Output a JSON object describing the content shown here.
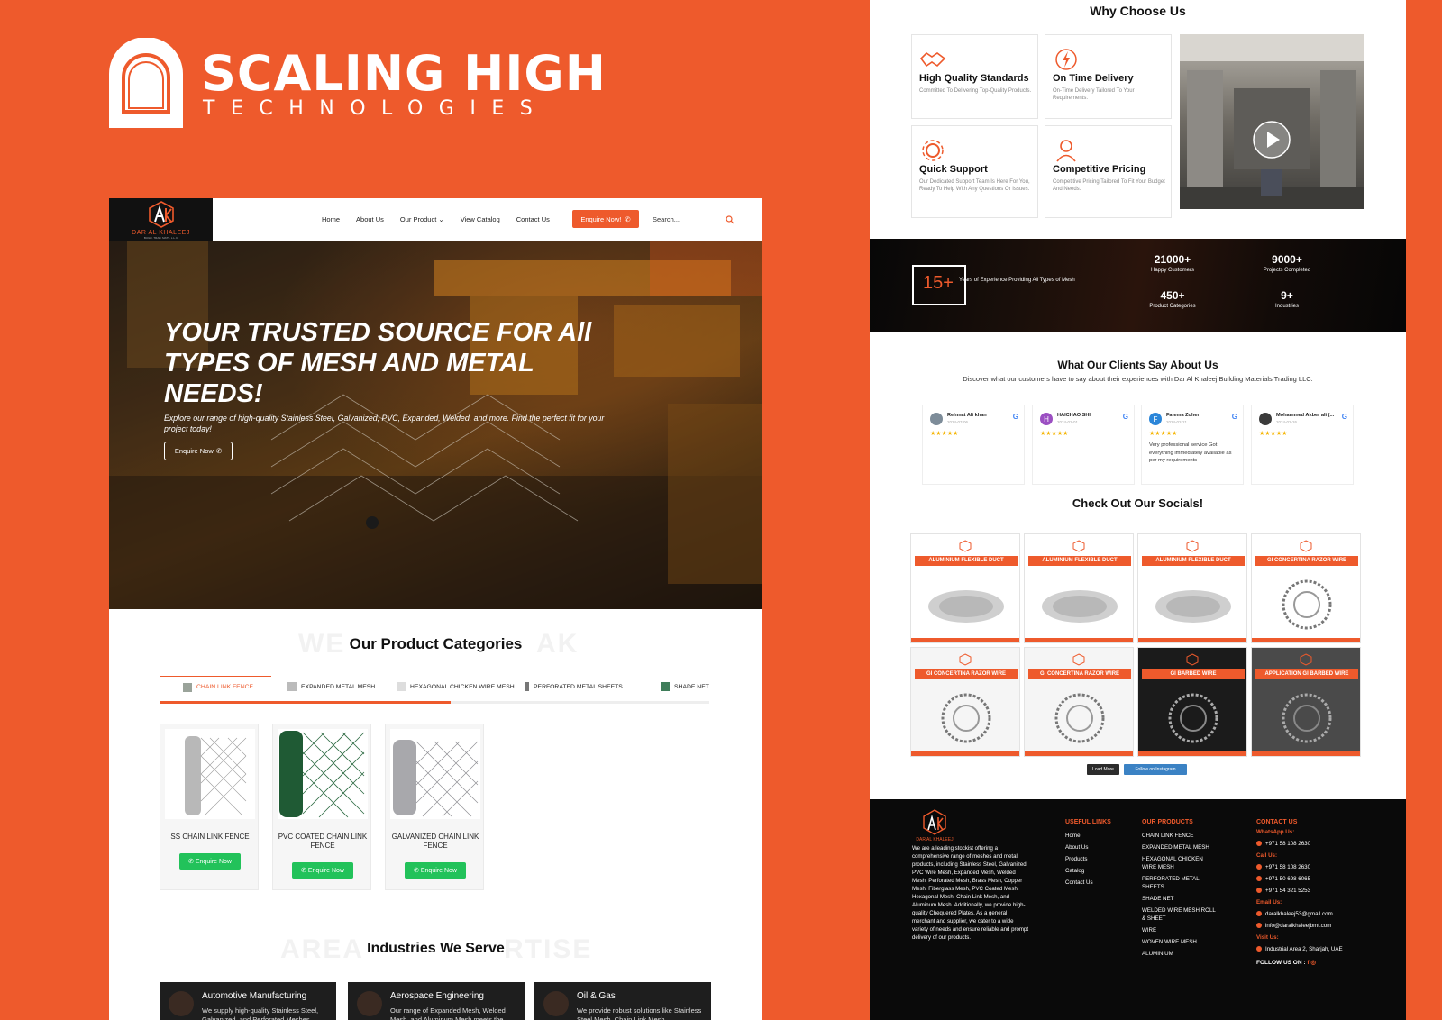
{
  "brand": {
    "name": "SCALING HIGH",
    "sub": "TECHNOLOGIES"
  },
  "site": {
    "logo_name": "DAR AL KHALEEJ",
    "logo_tag": "BUILD. TRAD. MATS. L.L.C",
    "nav": [
      "Home",
      "About Us",
      "Our Product",
      "View Catalog",
      "Contact Us"
    ],
    "enquire_label": "Enquire Now!",
    "search_placeholder": "Search...",
    "hero": {
      "title": "YOUR TRUSTED SOURCE FOR All TYPES OF MESH AND METAL NEEDS!",
      "desc": "Explore our range of high-quality Stainless Steel, Galvanized, PVC, Expanded, Welded, and more. Find the perfect fit for your project today!",
      "button": "Enquire Now"
    },
    "categories": {
      "ghost": "WE",
      "ghost2": "AK",
      "title": "Our Product Categories",
      "tabs": [
        "CHAIN LINK FENCE",
        "EXPANDED METAL MESH",
        "HEXAGONAL CHICKEN WIRE MESH",
        "PERFORATED METAL SHEETS",
        "SHADE NET"
      ],
      "progress": 0.53,
      "products": [
        {
          "name": "SS CHAIN LINK FENCE",
          "button": "Enquire Now"
        },
        {
          "name": "PVC COATED CHAIN LINK FENCE",
          "button": "Enquire Now"
        },
        {
          "name": "GALVANIZED CHAIN LINK FENCE",
          "button": "Enquire Now"
        }
      ]
    },
    "industries": {
      "ghost": "AREA",
      "ghost2": "RTISE",
      "title": "Industries We Serve",
      "items": [
        {
          "title": "Automotive Manufacturing",
          "desc": "We supply high-quality Stainless Steel, Galvanized, and Perforated Meshes"
        },
        {
          "title": "Aerospace Engineering",
          "desc": "Our range of Expanded Mesh, Welded Mesh, and Aluminum Mesh meets the"
        },
        {
          "title": "Oil & Gas",
          "desc": "We provide robust solutions like Stainless Steel Mesh, Chain Link Mesh"
        }
      ]
    }
  },
  "why": {
    "title": "Why Choose Us",
    "features": [
      {
        "title": "High Quality Standards",
        "desc": "Committed To Delivering Top-Quality Products.",
        "icon": "handshake-icon"
      },
      {
        "title": "On Time Delivery",
        "desc": "On-Time Delivery Tailored To Your Requirements.",
        "icon": "lightning-icon"
      },
      {
        "title": "Quick Support",
        "desc": "Our Dedicated Support Team Is Here For You, Ready To Help With Any Questions Or Issues.",
        "icon": "gear-icon"
      },
      {
        "title": "Competitive Pricing",
        "desc": "Competitive Pricing Tailored To Fit Your Budget And Needs.",
        "icon": "person-icon"
      }
    ]
  },
  "stats": {
    "years": "15+",
    "years_text": "Years of Experience Providing All Types of Mesh",
    "items": [
      {
        "num": "21000+",
        "label": "Happy Customers"
      },
      {
        "num": "9000+",
        "label": "Projects Completed"
      },
      {
        "num": "450+",
        "label": "Product Categories"
      },
      {
        "num": "9+",
        "label": "Industries"
      }
    ]
  },
  "clients": {
    "title": "What Our Clients Say About Us",
    "sub": "Discover what our customers have to say about their experiences with Dar Al Khaleej Building Materials Trading LLC.",
    "reviews": [
      {
        "initial": "",
        "name": "Rehmat Ali khan",
        "date": "2024-07-06",
        "text": "",
        "color": "#7d8c99"
      },
      {
        "initial": "H",
        "name": "HAICHAO SHI",
        "date": "2024-02-01",
        "text": "",
        "color": "#9b4fc2"
      },
      {
        "initial": "F",
        "name": "Fatema Zoher",
        "date": "2024-02-21",
        "text": "Very professional service Got everything immediately available as per my requirements",
        "color": "#2b86d9"
      },
      {
        "initial": "",
        "name": "Mohammed Akber ali (...",
        "date": "2024-02-26",
        "text": "",
        "color": "#3b3b3b"
      }
    ],
    "stars": "★★★★★",
    "g": "G"
  },
  "socials": {
    "title": "Check Out Our Socials!",
    "tiles": [
      {
        "banner": "ALUMINIUM FLEXIBLE DUCT"
      },
      {
        "banner": "ALUMINIUM FLEXIBLE DUCT"
      },
      {
        "banner": "ALUMINIUM FLEXIBLE DUCT"
      },
      {
        "banner": "GI CONCERTINA RAZOR WIRE"
      },
      {
        "banner": "GI CONCERTINA RAZOR WIRE"
      },
      {
        "banner": "GI CONCERTINA RAZOR WIRE"
      },
      {
        "banner": "GI BARBED WIRE"
      },
      {
        "banner": "APPLICATION GI BARBED WIRE"
      }
    ],
    "load_more": "Load More",
    "follow": "Follow on Instagram"
  },
  "footer": {
    "about": "We are a leading stockist offering a comprehensive range of meshes and metal products, including Stainless Steel, Galvanized, PVC Wire Mesh, Expanded Mesh, Welded Mesh, Perforated Mesh, Brass Mesh, Copper Mesh, Fiberglass Mesh, PVC Coated Mesh, Hexagonal Mesh, Chain Link Mesh, and Aluminum Mesh. Additionally, we provide high-quality Chequered Plates. As a general merchant and supplier, we cater to a wide variety of needs and ensure reliable and prompt delivery of our products.",
    "useful_title": "USEFUL LINKS",
    "useful": [
      "Home",
      "About Us",
      "Products",
      "Catalog",
      "Contact Us"
    ],
    "products_title": "OUR PRODUCTS",
    "products": [
      "CHAIN LINK FENCE",
      "EXPANDED METAL MESH",
      "HEXAGONAL CHICKEN WIRE MESH",
      "PERFORATED METAL SHEETS",
      "SHADE NET",
      "WELDED WIRE MESH ROLL & SHEET",
      "WIRE",
      "WOVEN WIRE MESH",
      "ALUMINIUM"
    ],
    "contact_title": "CONTACT US",
    "whatsapp_label": "WhatsApp Us:",
    "whatsapp": "+971 58 108 2630",
    "call_label": "Call Us:",
    "calls": [
      "+971 58 108 2630",
      "+971 50 698 6065",
      "+971 54 321 5253"
    ],
    "email_label": "Email Us:",
    "emails": [
      "daralkhaleej53@gmail.com",
      "info@daralkhaleejbmt.com"
    ],
    "visit_label": "Visit Us:",
    "address": "Industrial Area 2, Sharjah, UAE",
    "follow": "FOLLOW US ON :"
  },
  "colors": {
    "accent": "#EE5A2C",
    "whatsapp": "#22c25a",
    "dark": "#0a0a0a"
  }
}
